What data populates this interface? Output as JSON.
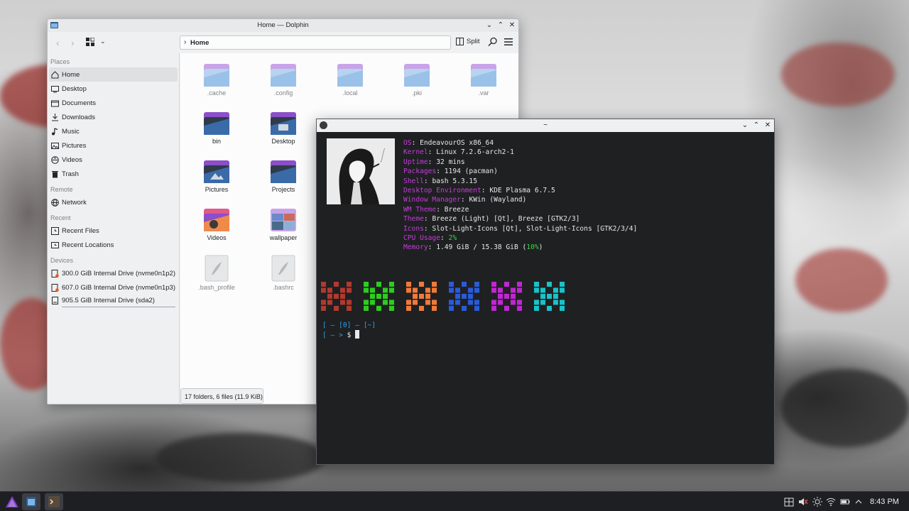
{
  "dolphin": {
    "title": "Home — Dolphin",
    "breadcrumb": "Home",
    "split_label": "Split",
    "status": "17 folders, 6 files (11.9 KiB)",
    "sidebar": {
      "places_header": "Places",
      "places": [
        "Home",
        "Desktop",
        "Documents",
        "Downloads",
        "Music",
        "Pictures",
        "Videos",
        "Trash"
      ],
      "remote_header": "Remote",
      "remote": [
        "Network"
      ],
      "recent_header": "Recent",
      "recent": [
        "Recent Files",
        "Recent Locations"
      ],
      "devices_header": "Devices",
      "devices": [
        "300.0 GiB Internal Drive (nvme0n1p2)",
        "607.0 GiB Internal Drive (nvme0n1p3)",
        "905.5 GiB Internal Drive (sda2)"
      ]
    },
    "files": [
      ".cache",
      ".config",
      ".local",
      ".pki",
      ".var",
      "bin",
      "Desktop",
      "Pictures",
      "Projects",
      "Videos",
      "wallpaper",
      ".bash_profile",
      ".bashrc"
    ]
  },
  "terminal": {
    "title": "~",
    "fetch": [
      {
        "key": "OS",
        "value": "EndeavourOS x86_64"
      },
      {
        "key": "Kernel",
        "value": "Linux 7.2.6-arch2-1"
      },
      {
        "key": "Uptime",
        "value": "32 mins"
      },
      {
        "key": "Packages",
        "value": "1194 (pacman)"
      },
      {
        "key": "Shell",
        "value": "bash 5.3.15"
      },
      {
        "key": "Desktop Environment",
        "value": "KDE Plasma 6.7.5"
      },
      {
        "key": "Window Manager",
        "value": "KWin (Wayland)"
      },
      {
        "key": "WM Theme",
        "value": "Breeze"
      },
      {
        "key": "Theme",
        "value": "Breeze (Light) [Qt], Breeze [GTK2/3]"
      },
      {
        "key": "Icons",
        "value": "Slot-Light-Icons [Qt], Slot-Light-Icons [GTK2/3/4]"
      }
    ],
    "cpu_key": "CPU Usage",
    "cpu_value": "2%",
    "mem_key": "Memory",
    "mem_value": "1.49 GiB / 15.38 GiB (",
    "mem_percent": "10%",
    "mem_close": ")",
    "swatch_colors": [
      "#b03a2e",
      "#2ecc1f",
      "#f07a3a",
      "#2a5bd7",
      "#c026d3",
      "#18c3c9"
    ],
    "prompt_line1_a": "[",
    "prompt_line1_b": " — [0] — ",
    "prompt_line1_c": "[~]",
    "prompt_line2_a": "[",
    "prompt_line2_b": " — > ",
    "prompt_line2_c": "$ "
  },
  "taskbar": {
    "clock": "8:43 PM"
  }
}
